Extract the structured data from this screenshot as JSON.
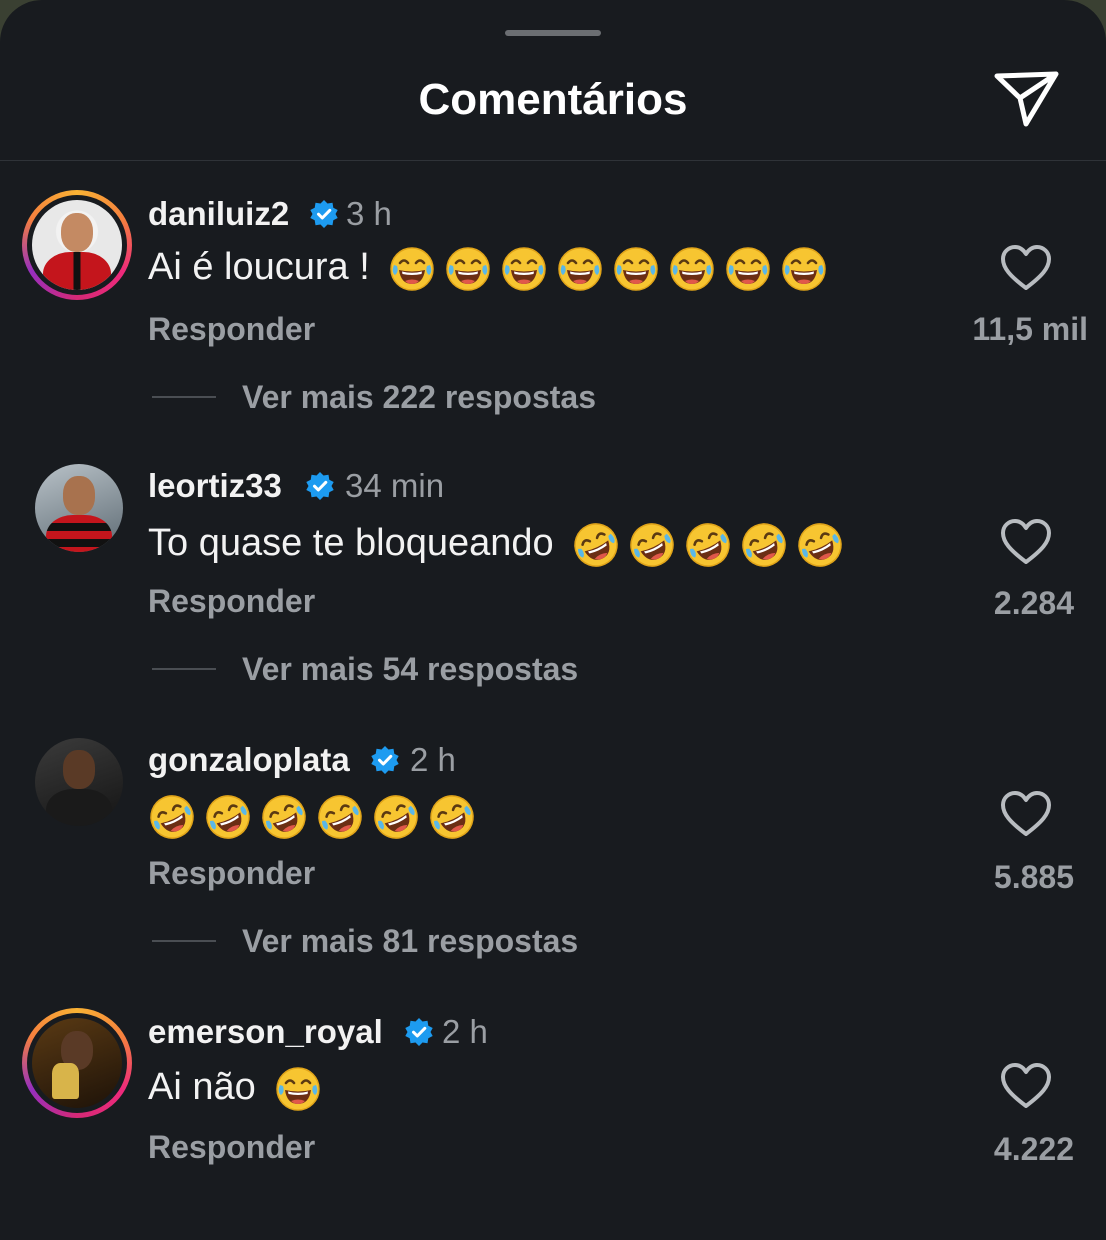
{
  "header": {
    "title": "Comentários",
    "send_icon": "paper-plane-icon"
  },
  "comments": [
    {
      "username": "daniluiz2",
      "verified": true,
      "time": "3 h",
      "text": "Ai é loucura !",
      "emoji": "😂",
      "emoji_count": 8,
      "reply_label": "Responder",
      "likes": "11,5 mil",
      "view_replies": "Ver mais 222 respostas",
      "has_story_ring": true
    },
    {
      "username": "leortiz33",
      "verified": true,
      "time": "34 min",
      "text": "To quase te bloqueando",
      "emoji": "🤣",
      "emoji_count": 5,
      "reply_label": "Responder",
      "likes": "2.284",
      "view_replies": "Ver mais 54 respostas",
      "has_story_ring": false
    },
    {
      "username": "gonzaloplata",
      "verified": true,
      "time": "2 h",
      "text": "",
      "emoji": "🤣",
      "emoji_count": 6,
      "reply_label": "Responder",
      "likes": "5.885",
      "view_replies": "Ver mais 81 respostas",
      "has_story_ring": false
    },
    {
      "username": "emerson_royal",
      "verified": true,
      "time": "2 h",
      "text": "Ai não",
      "emoji": "😂",
      "emoji_count": 1,
      "reply_label": "Responder",
      "likes": "4.222",
      "has_story_ring": true
    }
  ],
  "colors": {
    "background": "#181b1f",
    "text_primary": "#f2f2f2",
    "text_secondary": "#9a9ea3",
    "verified": "#1d9bf0"
  }
}
